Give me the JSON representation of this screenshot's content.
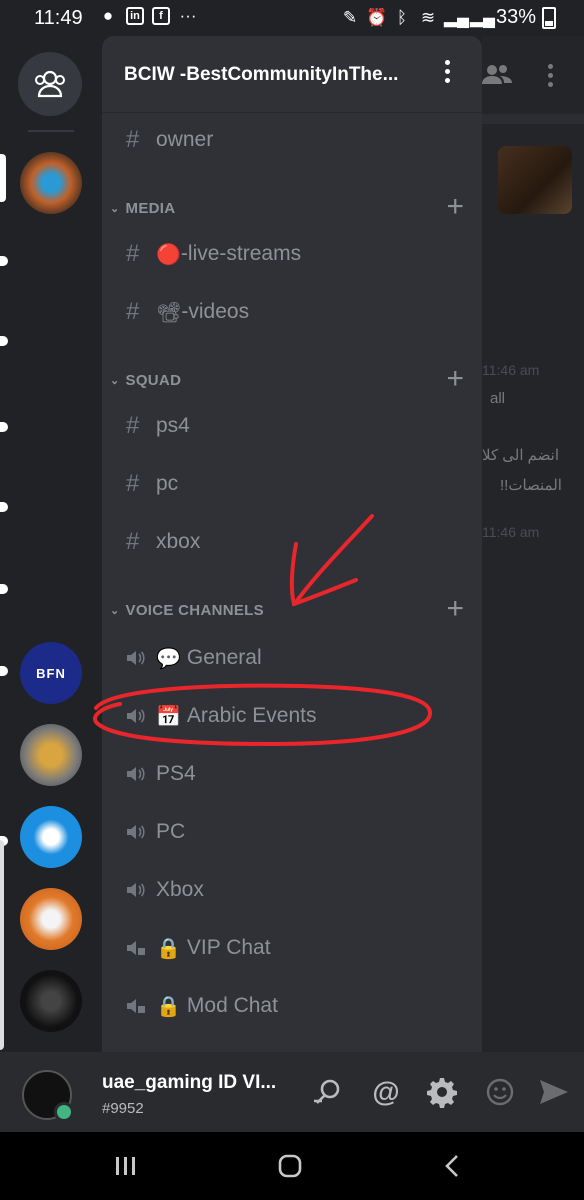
{
  "status_bar": {
    "time": "11:49",
    "battery": "33%"
  },
  "server": {
    "name": "BCIW -BestCommunityInThe..."
  },
  "channel_list": {
    "top_channel": "owner",
    "categories": [
      {
        "name": "MEDIA",
        "channels": [
          {
            "emoji": "🔴",
            "label": "-live-streams"
          },
          {
            "emoji": "📽",
            "label": "-videos"
          }
        ]
      },
      {
        "name": "SQUAD",
        "channels": [
          {
            "label": "ps4"
          },
          {
            "label": "pc"
          },
          {
            "label": "xbox"
          }
        ]
      },
      {
        "name": "VOICE CHANNELS",
        "channels": [
          {
            "emoji": "💬",
            "label": "General"
          },
          {
            "emoji": "📅",
            "label": "Arabic Events"
          },
          {
            "label": "PS4"
          },
          {
            "label": "PC"
          },
          {
            "label": "Xbox"
          },
          {
            "emoji": "🔒",
            "label": "VIP Chat"
          },
          {
            "emoji": "🔒",
            "label": "Mod Chat"
          }
        ]
      }
    ]
  },
  "chat_peek": {
    "time1": "11:46 am",
    "text1": "all",
    "arabic1": "انضم الى كلا",
    "arabic2": "المنصات!!",
    "time2": "11:46 am"
  },
  "user": {
    "name": "uae_gaming ID VI...",
    "discriminator": "#9952"
  },
  "icons": {
    "home": "friends-icon",
    "search": "search-icon",
    "mention": "at-icon",
    "settings": "gear-icon",
    "emoji": "emoji-icon",
    "send": "send-icon"
  },
  "colors": {
    "accent": "#7289da",
    "online": "#43b581",
    "annotation": "#e8262b"
  }
}
